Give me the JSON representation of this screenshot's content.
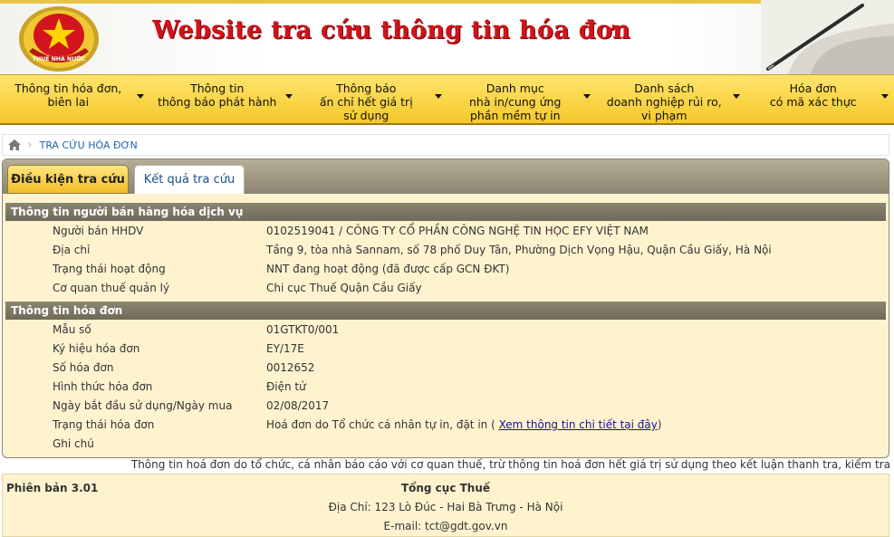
{
  "header": {
    "title": "Website tra cứu thông tin hóa đơn",
    "emblem_text": "THUẾ NHÀ NƯỚC",
    "colors": {
      "title": "#d0131b",
      "menu": "#f5c92b",
      "section": "#7d7766",
      "panel": "#fff3cf"
    }
  },
  "menu": [
    {
      "line1": "Thông tin hóa đơn,",
      "line2": "biên lai",
      "line3": ""
    },
    {
      "line1": "Thông tin",
      "line2": "thông báo phát hành",
      "line3": ""
    },
    {
      "line1": "Thông báo",
      "line2": "ấn chỉ hết giá trị",
      "line3": "sử dụng"
    },
    {
      "line1": "Danh mục",
      "line2": "nhà in/cung ứng",
      "line3": "phần mềm tự in"
    },
    {
      "line1": "Danh sách",
      "line2": "doanh nghiệp rủi ro,",
      "line3": "vi phạm"
    },
    {
      "line1": "Hóa đơn",
      "line2": "có mã xác thực",
      "line3": ""
    }
  ],
  "breadcrumb": {
    "home_icon": "home-icon",
    "current": "TRA CỨU HÓA ĐƠN"
  },
  "tabs": {
    "search": "Điều kiện tra cứu",
    "result": "Kết quả tra cứu"
  },
  "seller": {
    "heading": "Thông tin người bán hàng hóa dịch vụ",
    "rows": [
      {
        "label": "Người bán HHDV",
        "value": "0102519041 / CÔNG TY CỔ PHẦN CÔNG NGHỆ TIN HỌC EFY VIỆT NAM"
      },
      {
        "label": "Địa chỉ",
        "value": "Tầng 9, tòa nhà Sannam, số 78 phố Duy Tân, Phường Dịch Vọng Hậu, Quận Cầu Giấy, Hà Nội"
      },
      {
        "label": "Trạng thái hoạt động",
        "value": "NNT đang hoạt động (đã được cấp GCN ĐKT)"
      },
      {
        "label": "Cơ quan thuế quản lý",
        "value": "Chi cục Thuế Quận Cầu Giấy"
      }
    ]
  },
  "invoice": {
    "heading": "Thông tin hóa đơn",
    "rows": [
      {
        "label": "Mẫu số",
        "value": "01GTKT0/001"
      },
      {
        "label": "Ký hiệu hóa đơn",
        "value": "EY/17E"
      },
      {
        "label": "Số hóa đơn",
        "value": "0012652"
      },
      {
        "label": "Hình thức hóa đơn",
        "value": "Điện tử"
      },
      {
        "label": "Ngày bắt đầu sử dụng/Ngày mua",
        "value": "02/08/2017"
      },
      {
        "label": "Trạng thái hóa đơn",
        "value": "Hoá đơn do Tổ chức cá nhân tự in, đặt in (",
        "link": "Xem thông tin chi tiết tại đây",
        "suffix": ")"
      },
      {
        "label": "Ghi chú",
        "value": ""
      }
    ]
  },
  "notice": "Thông tin hoá đơn do tổ chức, cá nhân báo cáo với cơ quan thuế, trừ thông tin hoá đơn hết giá trị sử dụng theo kết luận thanh tra, kiểm tra",
  "footer": {
    "version": "Phiên bản 3.01",
    "org": "Tổng cục Thuế",
    "address": "Địa Chỉ: 123 Lò Đúc - Hai Bà Trưng - Hà Nội",
    "email": "E-mail: tct@gdt.gov.vn"
  }
}
